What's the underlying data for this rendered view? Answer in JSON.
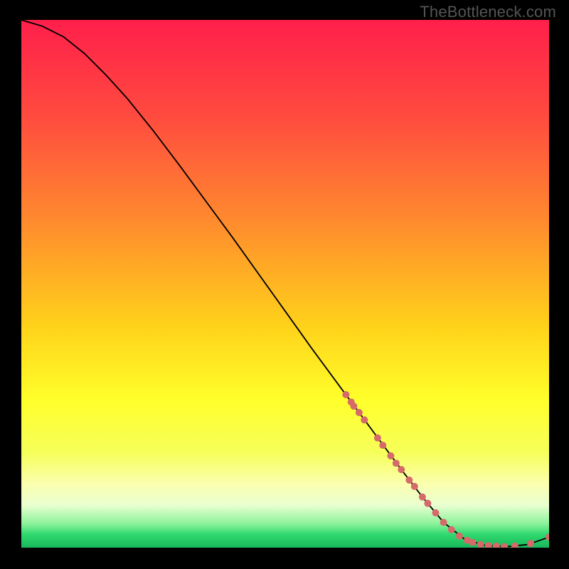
{
  "watermark": "TheBottleneck.com",
  "chart_data": {
    "type": "line",
    "title": "",
    "xlabel": "",
    "ylabel": "",
    "xlim": [
      0,
      100
    ],
    "ylim": [
      0,
      100
    ],
    "gradient_stops": [
      {
        "pos": 0.0,
        "color": "#ff1f4b"
      },
      {
        "pos": 0.18,
        "color": "#ff4a3f"
      },
      {
        "pos": 0.38,
        "color": "#ff8a2e"
      },
      {
        "pos": 0.58,
        "color": "#ffd21a"
      },
      {
        "pos": 0.72,
        "color": "#ffff2a"
      },
      {
        "pos": 0.82,
        "color": "#f6ff5a"
      },
      {
        "pos": 0.88,
        "color": "#fbffb0"
      },
      {
        "pos": 0.92,
        "color": "#e8ffd0"
      },
      {
        "pos": 0.955,
        "color": "#8bf29a"
      },
      {
        "pos": 0.975,
        "color": "#2fd96f"
      },
      {
        "pos": 1.0,
        "color": "#18b85a"
      }
    ],
    "series": [
      {
        "name": "bottleneck-curve",
        "x": [
          0,
          4,
          8,
          12,
          16,
          20,
          25,
          30,
          35,
          40,
          45,
          50,
          55,
          60,
          64,
          68,
          72,
          76,
          80,
          84,
          88,
          92,
          96,
          100
        ],
        "y": [
          100,
          98.8,
          96.8,
          93.6,
          89.6,
          85.2,
          79.0,
          72.4,
          65.6,
          58.8,
          51.8,
          44.8,
          37.8,
          31.0,
          25.6,
          20.2,
          14.8,
          9.6,
          4.8,
          1.6,
          0.4,
          0.2,
          0.6,
          2.0
        ]
      }
    ],
    "markers": {
      "name": "highlight-points",
      "color": "#d66a6a",
      "points": [
        {
          "x": 61.5,
          "y": 29.0,
          "r": 5
        },
        {
          "x": 62.5,
          "y": 27.6,
          "r": 5
        },
        {
          "x": 63.0,
          "y": 26.8,
          "r": 5
        },
        {
          "x": 64.0,
          "y": 25.6,
          "r": 5
        },
        {
          "x": 65.0,
          "y": 24.2,
          "r": 5
        },
        {
          "x": 67.5,
          "y": 20.8,
          "r": 5
        },
        {
          "x": 68.5,
          "y": 19.4,
          "r": 5
        },
        {
          "x": 70.0,
          "y": 17.4,
          "r": 5
        },
        {
          "x": 71.0,
          "y": 16.0,
          "r": 5
        },
        {
          "x": 72.0,
          "y": 14.8,
          "r": 5
        },
        {
          "x": 73.5,
          "y": 12.8,
          "r": 5
        },
        {
          "x": 74.5,
          "y": 11.6,
          "r": 5
        },
        {
          "x": 76.0,
          "y": 9.6,
          "r": 5
        },
        {
          "x": 77.0,
          "y": 8.4,
          "r": 5
        },
        {
          "x": 78.5,
          "y": 6.6,
          "r": 5
        },
        {
          "x": 80.0,
          "y": 4.8,
          "r": 5
        },
        {
          "x": 81.5,
          "y": 3.4,
          "r": 5
        },
        {
          "x": 83.0,
          "y": 2.2,
          "r": 5
        },
        {
          "x": 84.5,
          "y": 1.4,
          "r": 5
        },
        {
          "x": 85.5,
          "y": 1.0,
          "r": 5
        },
        {
          "x": 87.0,
          "y": 0.6,
          "r": 5
        },
        {
          "x": 88.5,
          "y": 0.4,
          "r": 5
        },
        {
          "x": 90.0,
          "y": 0.3,
          "r": 5
        },
        {
          "x": 91.5,
          "y": 0.2,
          "r": 5
        },
        {
          "x": 93.5,
          "y": 0.3,
          "r": 5
        },
        {
          "x": 96.5,
          "y": 0.8,
          "r": 5
        },
        {
          "x": 100.0,
          "y": 2.0,
          "r": 5
        }
      ]
    }
  }
}
